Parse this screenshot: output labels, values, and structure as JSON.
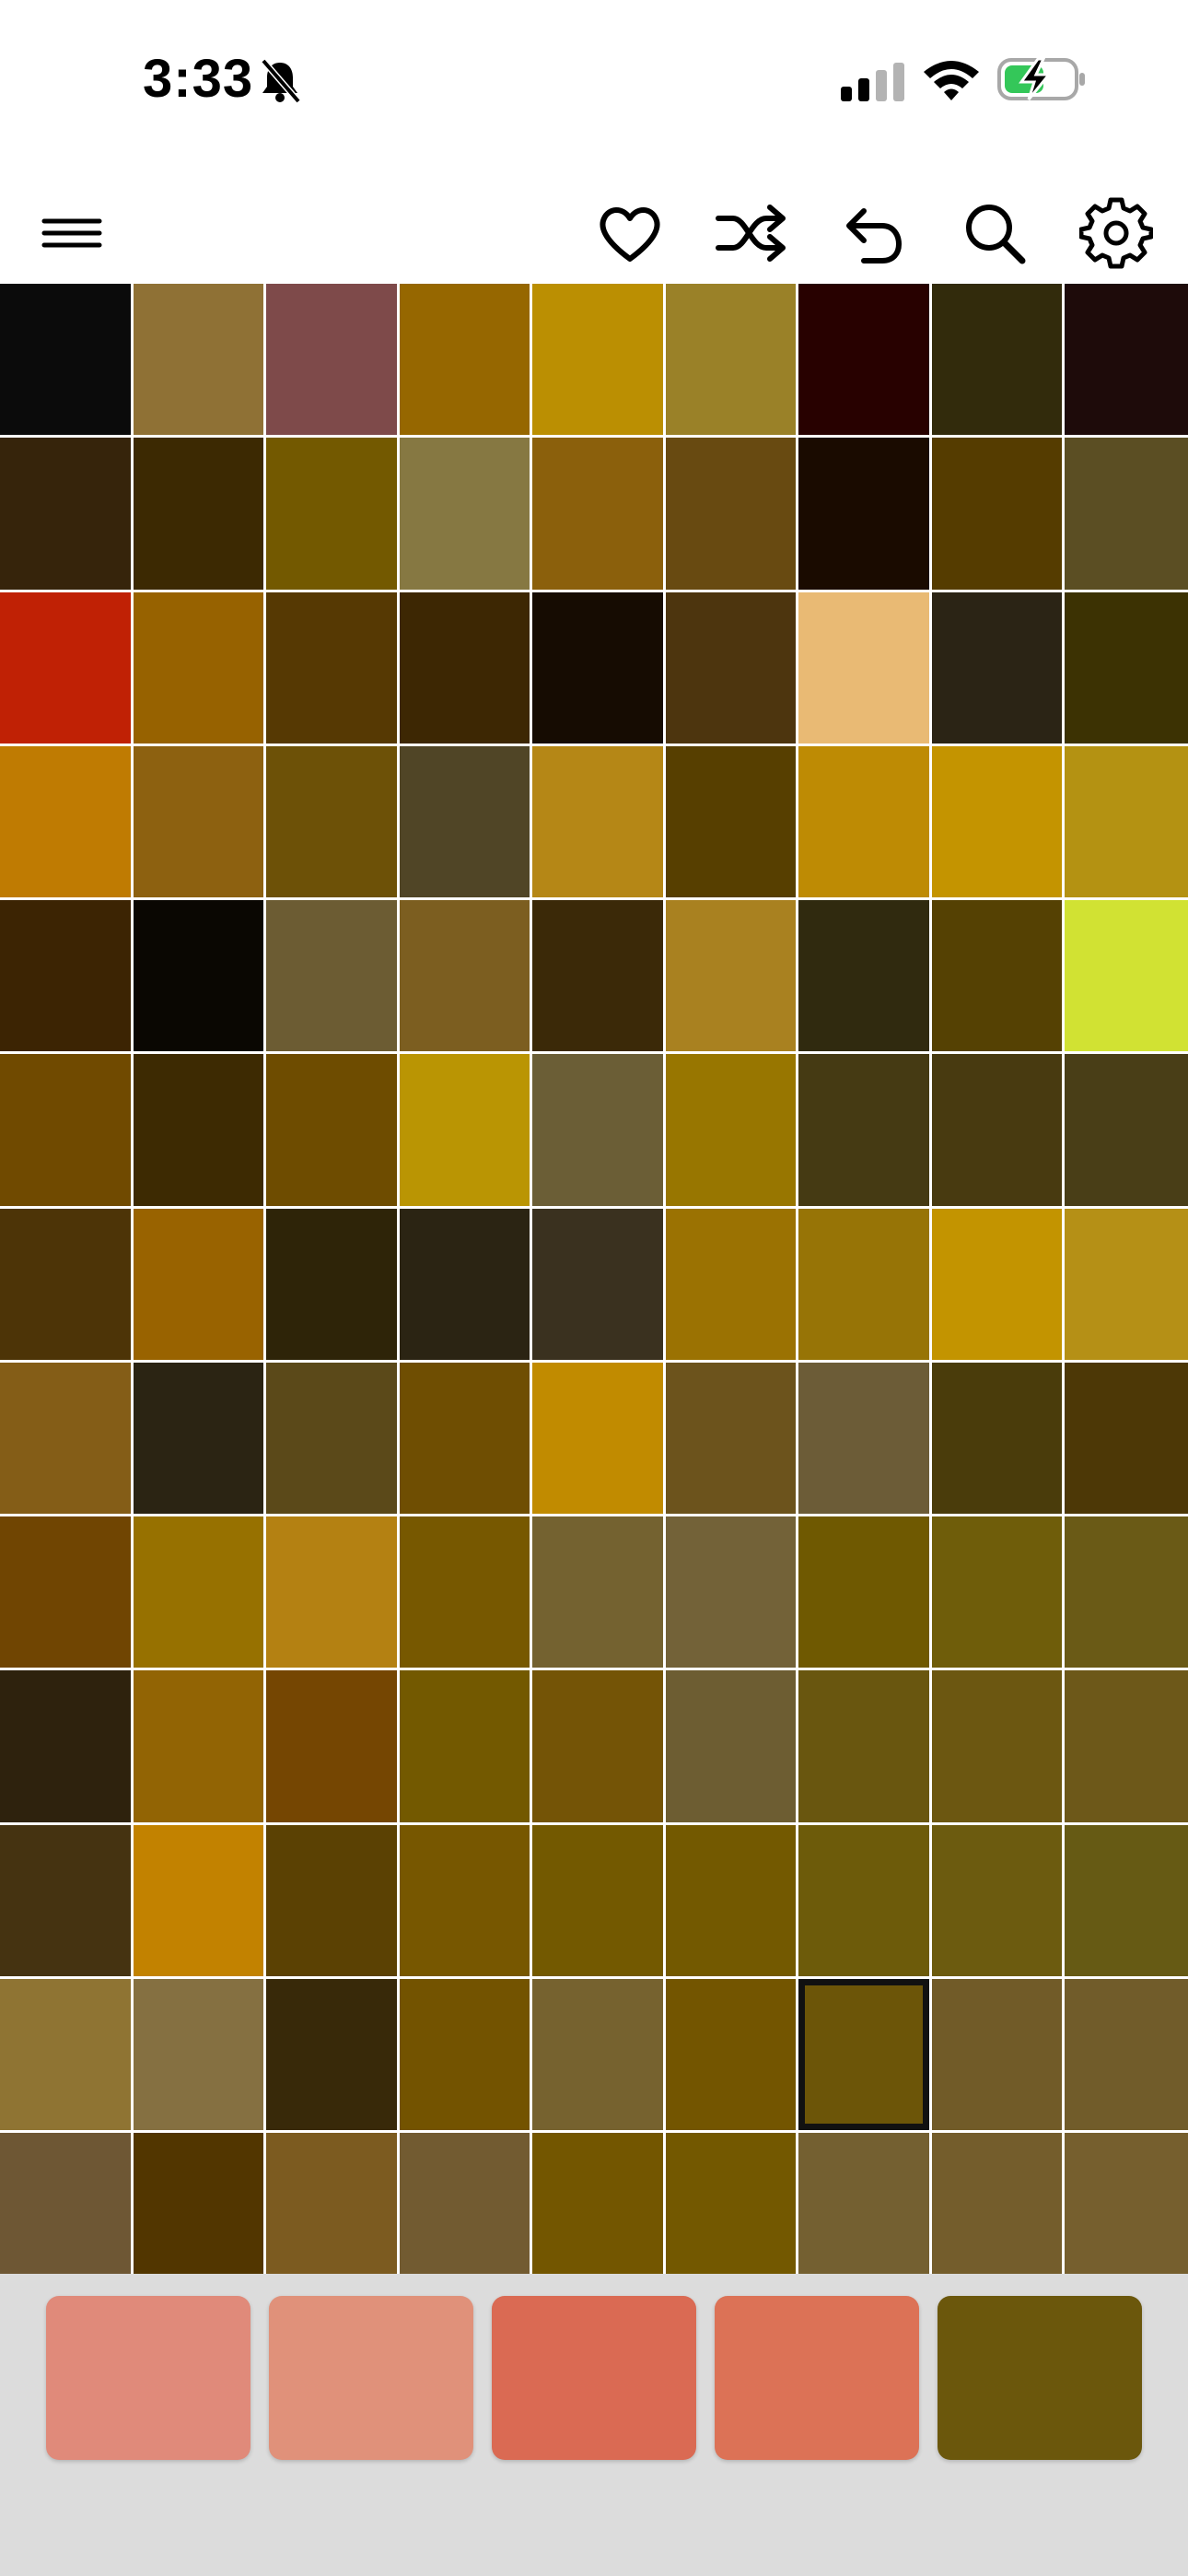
{
  "status": {
    "time": "3:33",
    "icons": [
      "bell-slash-icon",
      "cellular-signal-icon",
      "wifi-icon",
      "battery-charging-icon"
    ],
    "battery_color": "#34c759"
  },
  "toolbar": {
    "icons": [
      "menu-icon",
      "heart-icon",
      "shuffle-icon",
      "undo-icon",
      "search-icon",
      "gear-icon"
    ]
  },
  "grid": {
    "columns": 9,
    "rows": 13,
    "selected_index": 105,
    "colors": [
      "#0b0b0b",
      "#8f7135",
      "#7e4a4a",
      "#966700",
      "#bb8f02",
      "#9a8128",
      "#280100",
      "#322b0c",
      "#1e0b0a",
      "#36240b",
      "#3c2902",
      "#735900",
      "#867842",
      "#8b600c",
      "#684a11",
      "#1a0b00",
      "#553c00",
      "#5b4e23",
      "#c02105",
      "#976200",
      "#563903",
      "#3d2703",
      "#160c02",
      "#4d350e",
      "#e9ba74",
      "#2b2415",
      "#3c3203",
      "#bf7b02",
      "#8d6110",
      "#6d5107",
      "#504526",
      "#b58716",
      "#573f00",
      "#be8b04",
      "#c49400",
      "#b49212",
      "#3c2403",
      "#0a0702",
      "#6c5c33",
      "#7c5e20",
      "#3b2908",
      "#a98120",
      "#302a0f",
      "#554103",
      "#d1e233",
      "#704a00",
      "#3d2a02",
      "#6e4c00",
      "#ba9503",
      "#6b5e36",
      "#987600",
      "#453a13",
      "#483a10",
      "#493e17",
      "#4d3407",
      "#996300",
      "#2e2408",
      "#2b2413",
      "#3a311f",
      "#9b7202",
      "#977406",
      "#c39400",
      "#b59016",
      "#845d17",
      "#2b2413",
      "#5b4919",
      "#6f4e02",
      "#c18b00",
      "#6c531c",
      "#6c5c37",
      "#4a3c0b",
      "#4d3806",
      "#704502",
      "#977100",
      "#b48112",
      "#775800",
      "#746230",
      "#736238",
      "#6f5901",
      "#6f5d0a",
      "#6a5a16",
      "#2e220d",
      "#926404",
      "#754602",
      "#735900",
      "#745406",
      "#6d5d32",
      "#69560f",
      "#6c5711",
      "#6d5819",
      "#453311",
      "#c28200",
      "#5b4103",
      "#775700",
      "#735900",
      "#735900",
      "#6d5b0a",
      "#6c5b0f",
      "#665a14",
      "#8f7433",
      "#857041",
      "#382909",
      "#735300",
      "#76622f",
      "#735500",
      "#6c5508",
      "#715b28",
      "#715c2a",
      "#6e5734",
      "#523600",
      "#7c5b20",
      "#725b31",
      "#735600",
      "#735800",
      "#746031",
      "#745d2c",
      "#765f2e"
    ]
  },
  "palette": {
    "swatches": [
      "#e08a7a",
      "#e0917a",
      "#da6a53",
      "#dc7256",
      "#6b570c"
    ]
  }
}
